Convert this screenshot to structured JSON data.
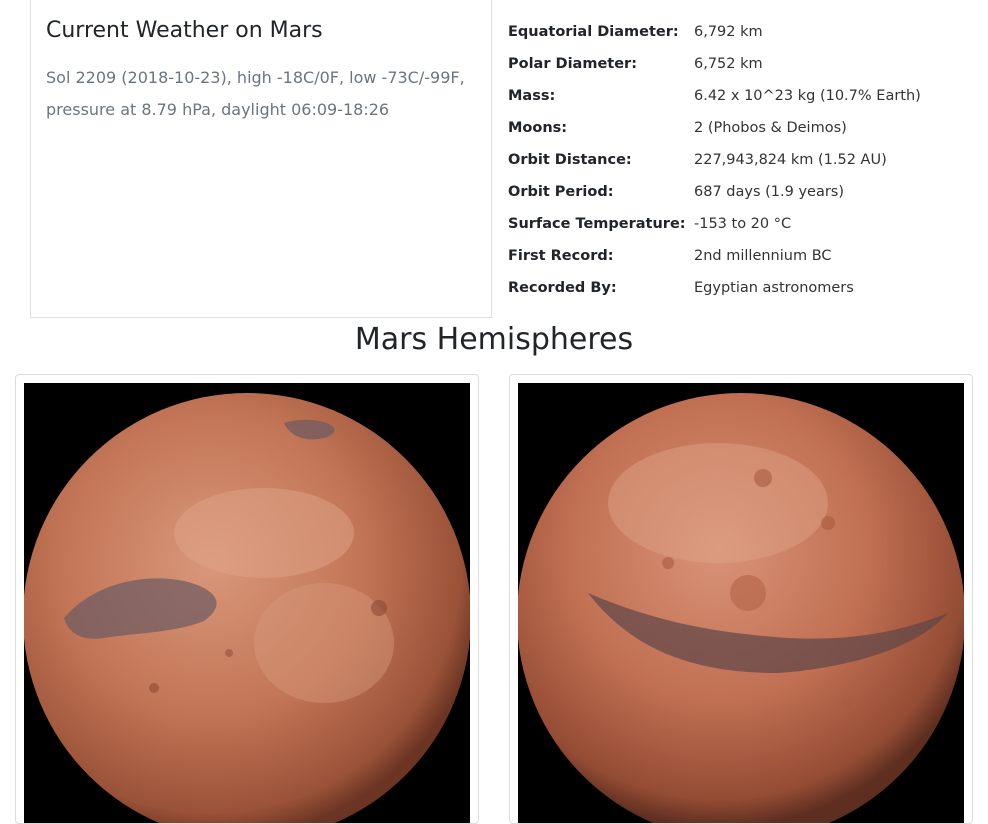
{
  "weather": {
    "title": "Current Weather on Mars",
    "text": "Sol 2209 (2018-10-23), high -18C/0F, low -73C/-99F, pressure at 8.79 hPa, daylight 06:09-18:26"
  },
  "facts": [
    {
      "label": "Equatorial Diameter:",
      "value": "6,792 km"
    },
    {
      "label": "Polar Diameter:",
      "value": "6,752 km"
    },
    {
      "label": "Mass:",
      "value": "6.42 x 10^23 kg (10.7% Earth)"
    },
    {
      "label": "Moons:",
      "value": "2 (Phobos & Deimos)"
    },
    {
      "label": "Orbit Distance:",
      "value": "227,943,824 km (1.52 AU)"
    },
    {
      "label": "Orbit Period:",
      "value": "687 days (1.9 years)"
    },
    {
      "label": "Surface Temperature:",
      "value": "-153 to 20 °C"
    },
    {
      "label": "First Record:",
      "value": "2nd millennium BC"
    },
    {
      "label": "Recorded By:",
      "value": "Egyptian astronomers"
    }
  ],
  "hemispheres": {
    "title": "Mars Hemispheres"
  },
  "colors": {
    "mars_light": "#d28c6a",
    "mars_base": "#b8674a",
    "mars_dark": "#6e3a2c",
    "mars_maria": "#5a4a52"
  }
}
